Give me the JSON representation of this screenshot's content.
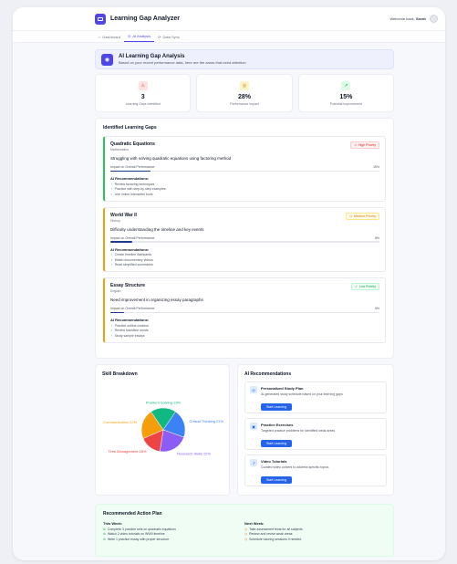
{
  "app": {
    "title": "Learning Gap Analyzer",
    "welcome_prefix": "Welcome back,",
    "user": "Sarah"
  },
  "tabs": [
    {
      "label": "Dashboard",
      "icon": "home-icon"
    },
    {
      "label": "AI Analysis",
      "icon": "brain-icon",
      "active": true
    },
    {
      "label": "Data Sync",
      "icon": "sync-icon"
    }
  ],
  "banner": {
    "title": "AI Learning Gap Analysis",
    "subtitle": "Based on your recent performance data, here are the areas that need attention"
  },
  "stats": [
    {
      "value": "3",
      "label": "Learning Gaps Identified",
      "icon": "alert-triangle-icon",
      "color": "#ef4444",
      "bg": "#fee2e2"
    },
    {
      "value": "28%",
      "label": "Performance Impact",
      "icon": "target-icon",
      "color": "#d97706",
      "bg": "#fef3c7"
    },
    {
      "value": "15%",
      "label": "Potential Improvement",
      "icon": "trending-up-icon",
      "color": "#16a34a",
      "bg": "#dcfce7"
    }
  ],
  "gaps_section": {
    "title": "Identified Learning Gaps",
    "impact_label": "Impact on Overall Performance",
    "recs_title": "AI Recommendations:",
    "items": [
      {
        "title": "Quadratic Equations",
        "subject": "Mathematics",
        "description": "Struggling with solving quadratic equations using factoring method",
        "impact": "15%",
        "impact_value": 15,
        "priority": "High Priority",
        "priority_color": "#dc2626",
        "priority_bg": "#fef2f2",
        "border": "#22c55e",
        "recs": [
          "Review factoring techniques",
          "Practice with step-by-step examples",
          "Use online interactive tools"
        ]
      },
      {
        "title": "World War II",
        "subject": "History",
        "description": "Difficulty understanding the timeline and key events",
        "impact": "8%",
        "impact_value": 8,
        "priority": "Medium Priority",
        "priority_color": "#d97706",
        "priority_bg": "#fffbeb",
        "border": "#f59e0b",
        "recs": [
          "Create timeline flashcards",
          "Watch documentary videos",
          "Read simplified summaries"
        ]
      },
      {
        "title": "Essay Structure",
        "subject": "English",
        "description": "Need improvement in organizing essay paragraphs",
        "impact": "5%",
        "impact_value": 5,
        "priority": "Low Priority",
        "priority_color": "#16a34a",
        "priority_bg": "#f0fdf4",
        "border": "#f59e0b",
        "recs": [
          "Practice outline creation",
          "Review transition words",
          "Study sample essays"
        ]
      }
    ]
  },
  "skill_section": {
    "title": "Skill Breakdown"
  },
  "chart_data": {
    "type": "pie",
    "categories": [
      "Problem Solving",
      "Critical Thinking",
      "Research Skills",
      "Time Management",
      "Communication"
    ],
    "values": [
      19,
      21,
      22,
      16,
      22
    ],
    "labels": [
      "Problem Solving 19%",
      "Critical Thinking 21%",
      "Research Skills 22%",
      "Time Management 16%",
      "Communication 22%"
    ],
    "colors": [
      "#10b981",
      "#3b82f6",
      "#8b5cf6",
      "#ef4444",
      "#f59e0b"
    ]
  },
  "ai_recs": {
    "title": "AI Recommendations",
    "button_label": "Start Learning",
    "items": [
      {
        "title": "Personalized Study Plan",
        "description": "AI-generated study schedule based on your learning gaps",
        "icon": "target-icon"
      },
      {
        "title": "Practice Exercises",
        "description": "Targeted practice problems for identified weak areas",
        "icon": "book-icon"
      },
      {
        "title": "Video Tutorials",
        "description": "Curated video content to address specific topics",
        "icon": "trending-up-icon"
      }
    ]
  },
  "plan": {
    "title": "Recommended Action Plan",
    "this_week_title": "This Week:",
    "this_week": [
      "Complete 3 practice sets on quadratic equations",
      "Watch 2 video tutorials on WWII timeline",
      "Write 1 practice essay with proper structure"
    ],
    "next_week_title": "Next Week:",
    "next_week": [
      "Take assessment tests for all subjects",
      "Review and revise weak areas",
      "Schedule tutoring sessions if needed"
    ]
  }
}
